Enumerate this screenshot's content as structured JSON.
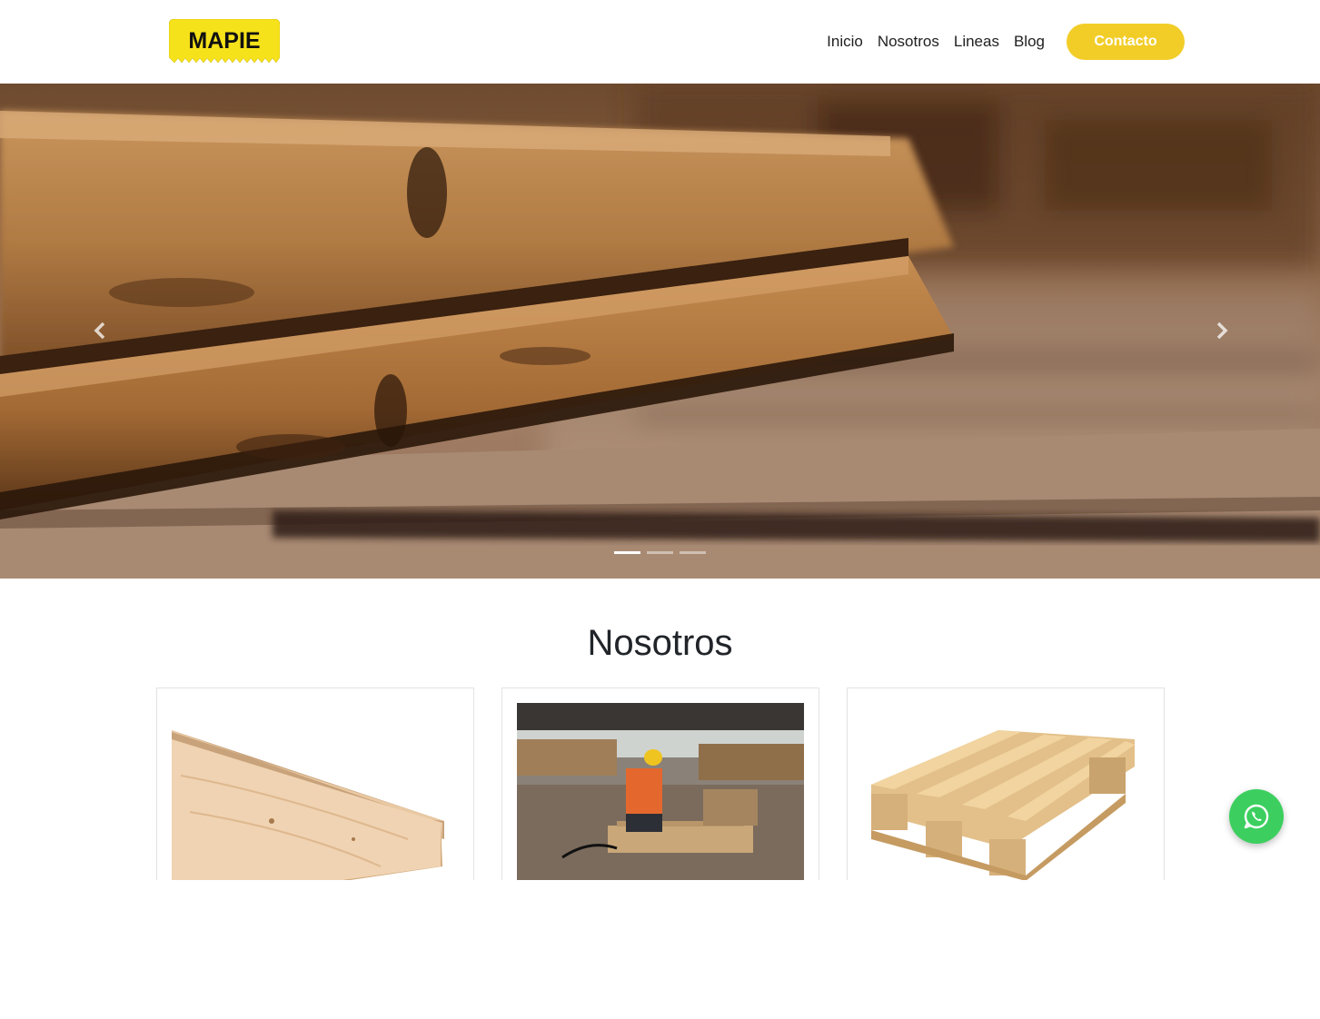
{
  "brand": {
    "logo_text": "MAPIE",
    "logo_color": "#f6e21a"
  },
  "nav": {
    "links": [
      {
        "label": "Inicio"
      },
      {
        "label": "Nosotros"
      },
      {
        "label": "Lineas"
      },
      {
        "label": "Blog"
      }
    ],
    "cta_label": "Contacto",
    "cta_color": "#f2cd28"
  },
  "hero": {
    "prev_icon": "chevron-left-icon",
    "next_icon": "chevron-right-icon",
    "slide_count": 3,
    "active_slide": 1
  },
  "about": {
    "title": "Nosotros",
    "cards": [
      {
        "image": "wood-plank-image"
      },
      {
        "image": "worker-building-pallet-image"
      },
      {
        "image": "wooden-pallet-image"
      }
    ]
  },
  "whatsapp": {
    "icon": "whatsapp-icon",
    "color": "#3ccf5f"
  }
}
